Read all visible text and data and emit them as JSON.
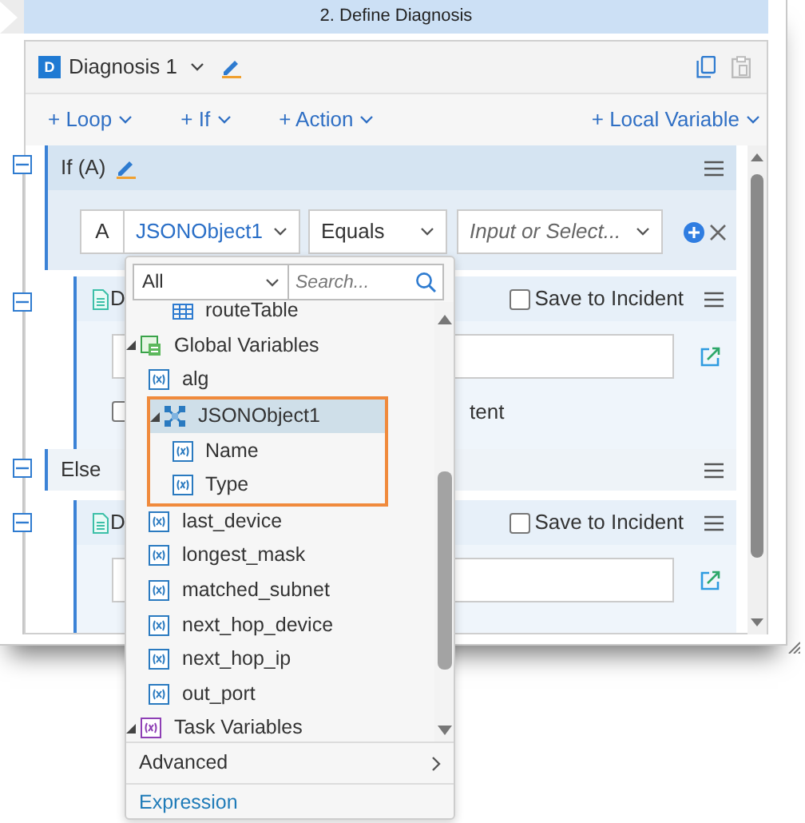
{
  "step": {
    "title": "2. Define Diagnosis"
  },
  "diagnosis": {
    "badge": "D",
    "name": "Diagnosis 1"
  },
  "toolbar": [
    {
      "label": "+ Loop"
    },
    {
      "label": "+ If"
    },
    {
      "label": "+ Action"
    },
    {
      "label": "+ Local Variable"
    }
  ],
  "flow": [
    {
      "kind": "if",
      "title": "If (A)",
      "expanded": true,
      "condition": {
        "letter": "A",
        "variable": "JSONObject1",
        "operator": "Equals",
        "placeholder": "Input or Select..."
      }
    },
    {
      "kind": "diagnosis",
      "title": "D",
      "expanded": true,
      "save_label": "Save to Incident",
      "save_checked": false,
      "option_checked": false,
      "option_label": "tent"
    },
    {
      "kind": "else",
      "title": "Else",
      "expanded": true
    },
    {
      "kind": "diagnosis",
      "title": "D",
      "expanded": true,
      "save_label": "Save to Incident",
      "save_checked": false
    }
  ],
  "dropdown": {
    "filter": "All",
    "search": {
      "placeholder": "Search..."
    },
    "tree": [
      {
        "children": [
          {
            "children": [
              {
                "label": "routeTable",
                "kind": "table",
                "selected": false,
                "highlighted": false
              }
            ]
          }
        ]
      },
      {
        "label": "Global Variables",
        "kind": "global",
        "expanded": true,
        "selected": false,
        "highlighted": false,
        "children": [
          {
            "label": "alg",
            "kind": "variable",
            "selected": false,
            "highlighted": false
          },
          {
            "label": "JSONObject1",
            "kind": "object",
            "expanded": true,
            "selected": true,
            "highlighted": true,
            "children": [
              {
                "label": "Name",
                "kind": "field",
                "selected": false,
                "highlighted": false
              },
              {
                "label": "Type",
                "kind": "field",
                "selected": false,
                "highlighted": false
              }
            ]
          },
          {
            "label": "last_device",
            "kind": "variable",
            "selected": false,
            "highlighted": false
          },
          {
            "label": "longest_mask",
            "kind": "variable",
            "selected": false,
            "highlighted": false
          },
          {
            "label": "matched_subnet",
            "kind": "variable",
            "selected": false,
            "highlighted": false
          },
          {
            "label": "next_hop_device",
            "kind": "variable",
            "selected": false,
            "highlighted": false
          },
          {
            "label": "next_hop_ip",
            "kind": "variable",
            "selected": false,
            "highlighted": false
          },
          {
            "label": "out_port",
            "kind": "variable",
            "selected": false,
            "highlighted": false
          }
        ]
      },
      {
        "label": "Task Variables",
        "kind": "task",
        "expanded": true,
        "selected": false,
        "highlighted": false
      }
    ],
    "footer": [
      {
        "kind": "submenu",
        "label": "Advanced"
      },
      {
        "kind": "link",
        "label": "Expression"
      }
    ]
  }
}
